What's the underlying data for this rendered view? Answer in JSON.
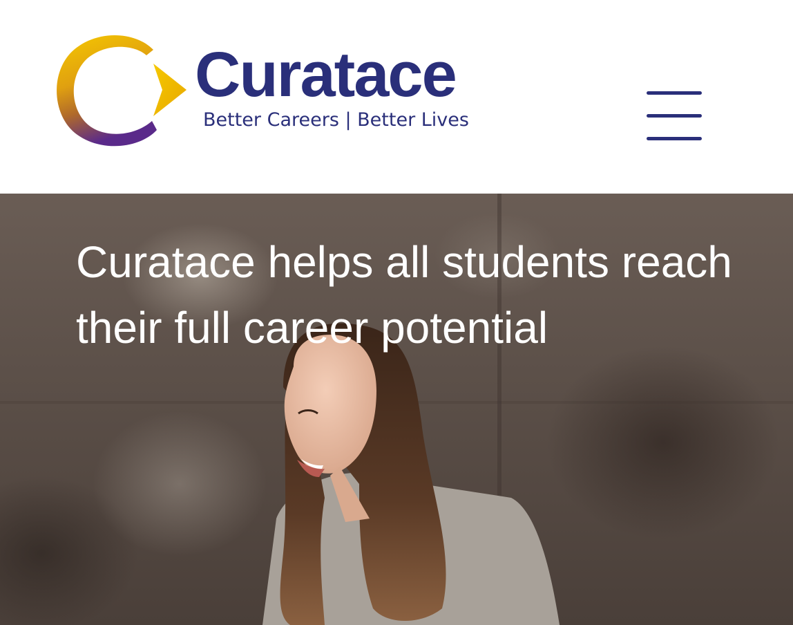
{
  "header": {
    "logo": {
      "wordmark": "Curatace",
      "tagline": "Better Careers | Better Lives",
      "colors": {
        "navy": "#2a2f7a",
        "gold": "#f2c200",
        "purple": "#5a2a8a"
      }
    },
    "menu_icon": "hamburger-menu-icon"
  },
  "hero": {
    "title": "Curatace helps all students reach their full career potential",
    "photo": "smiling-student-photo"
  }
}
